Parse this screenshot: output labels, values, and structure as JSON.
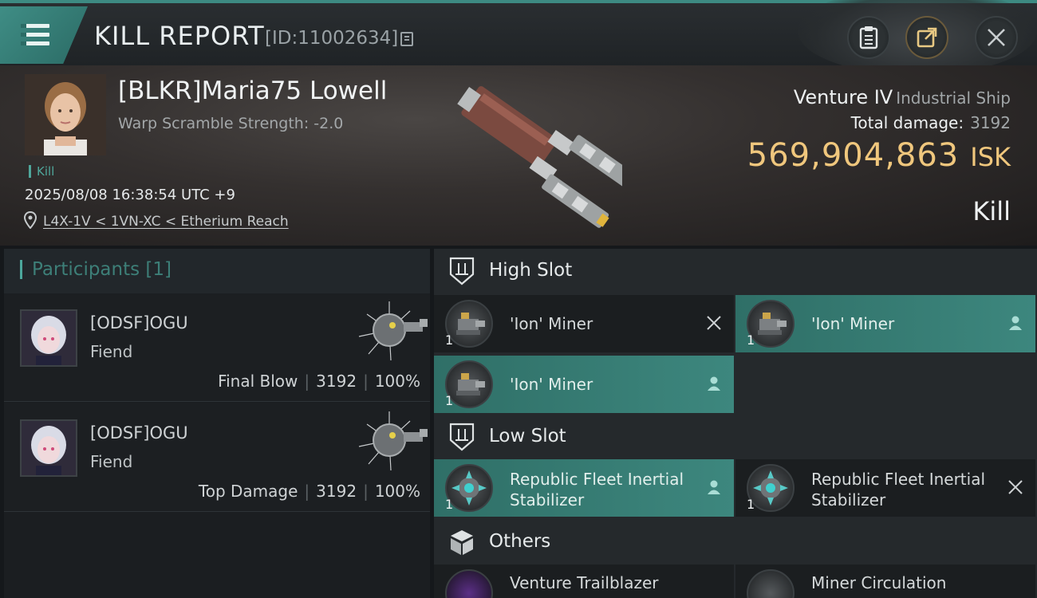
{
  "header": {
    "title": "KILL REPORT",
    "report_id": "[ID:11002634]",
    "buttons": [
      "clipboard-icon",
      "share-icon",
      "close-icon"
    ]
  },
  "victim": {
    "name": "[BLKR]Maria75 Lowell",
    "warp_scramble": "Warp Scramble Strength: -2.0",
    "tag": "Kill",
    "datetime": "2025/08/08 16:38:54 UTC +9",
    "location": "L4X-1V < 1VN-XC < Etherium Reach"
  },
  "ship": {
    "name": "Venture IV",
    "class": "Industrial Ship",
    "total_damage_label": "Total damage:",
    "total_damage": "3192",
    "value": "569,904,863",
    "value_unit": "ISK",
    "result": "Kill"
  },
  "participants": {
    "header": "Participants",
    "count": "[1]",
    "rows": [
      {
        "name": "[ODSF]OGU",
        "ship": "Fiend",
        "role": "Final Blow",
        "damage": "3192",
        "percent": "100%"
      },
      {
        "name": "[ODSF]OGU",
        "ship": "Fiend",
        "role": "Top Damage",
        "damage": "3192",
        "percent": "100%"
      }
    ]
  },
  "fitting": {
    "high_slot": {
      "label": "High Slot",
      "modules": [
        {
          "name": "'Ion' Miner",
          "qty": "1",
          "status": "destroyed",
          "highlight": false
        },
        {
          "name": "'Ion' Miner",
          "qty": "1",
          "status": "dropped",
          "highlight": true
        },
        {
          "name": "'Ion' Miner",
          "qty": "1",
          "status": "dropped",
          "highlight": true
        }
      ]
    },
    "low_slot": {
      "label": "Low Slot",
      "modules": [
        {
          "name_line1": "Republic Fleet Inertial",
          "name_line2": "Stabilizer",
          "qty": "1",
          "status": "dropped",
          "highlight": true
        },
        {
          "name_line1": "Republic Fleet Inertial",
          "name_line2": "Stabilizer",
          "qty": "1",
          "status": "destroyed",
          "highlight": false
        }
      ]
    },
    "others": {
      "label": "Others",
      "modules": [
        {
          "name": "Venture Trailblazer"
        },
        {
          "name": "Miner Circulation"
        }
      ]
    }
  },
  "colors": {
    "accent": "#3d877e",
    "isk": "#f0c77d",
    "panel": "#1b1e21"
  }
}
